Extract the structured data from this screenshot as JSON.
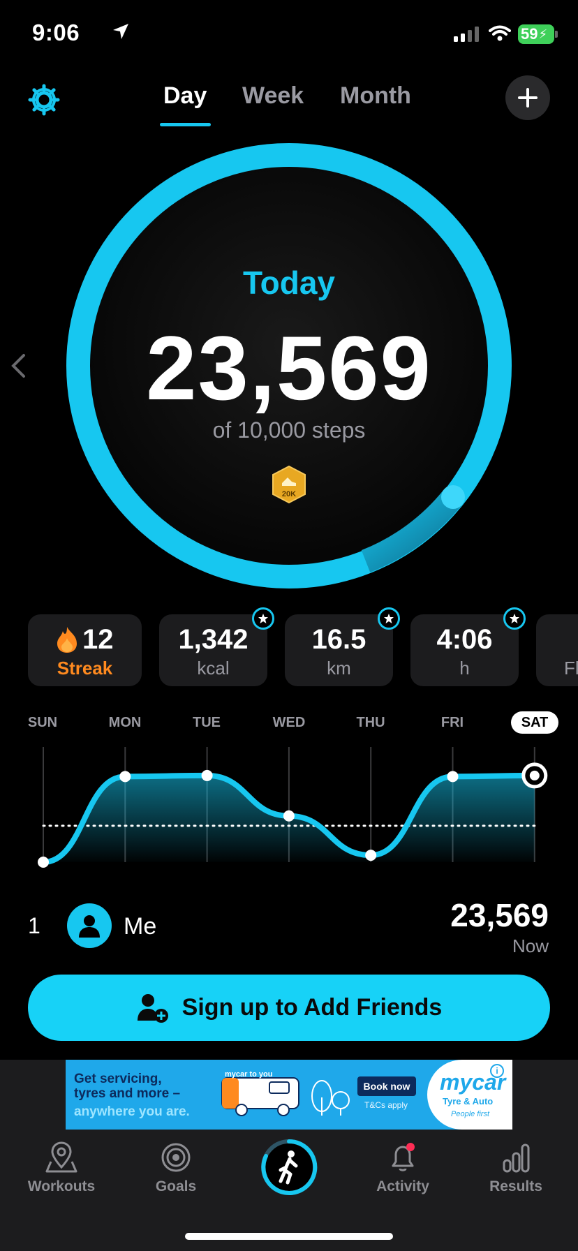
{
  "status_bar": {
    "time": "9:06",
    "battery": "59"
  },
  "header": {
    "tabs": [
      {
        "label": "Day",
        "active": true
      },
      {
        "label": "Week",
        "active": false
      },
      {
        "label": "Month",
        "active": false
      }
    ]
  },
  "today": {
    "label": "Today",
    "steps": "23,569",
    "goal_text": "of 10,000 steps",
    "badge": "20K",
    "goal_progress": 1.0
  },
  "stats": [
    {
      "value": "12",
      "unit": "Streak"
    },
    {
      "value": "1,342",
      "unit": "kcal"
    },
    {
      "value": "16.5",
      "unit": "km"
    },
    {
      "value": "4:06",
      "unit": "h"
    },
    {
      "value": "",
      "unit": "Fl"
    }
  ],
  "week_chart": {
    "days": [
      "SUN",
      "MON",
      "TUE",
      "WED",
      "THU",
      "FRI",
      "SAT"
    ],
    "selected_day": "SAT",
    "relative_values": [
      0.0,
      0.87,
      0.88,
      0.47,
      0.07,
      0.87,
      0.88
    ],
    "goal_level": 0.37
  },
  "leaderboard": {
    "rank": "1",
    "name": "Me",
    "steps": "23,569",
    "time": "Now"
  },
  "signup_button": "Sign up to Add Friends",
  "ad": {
    "line1": "Get servicing,",
    "line2": "tyres and more –",
    "line3": "anywhere you are.",
    "van_label": "mycar to you",
    "cta": "Book now",
    "terms": "T&Cs apply",
    "brand": "mycar",
    "tagline": "Tyre & Auto",
    "slogan": "People first"
  },
  "nav": [
    {
      "label": "Workouts",
      "icon": "map-pin-icon"
    },
    {
      "label": "Goals",
      "icon": "target-icon"
    },
    {
      "label": "",
      "icon": "walking-icon"
    },
    {
      "label": "Activity",
      "icon": "bell-icon"
    },
    {
      "label": "Results",
      "icon": "bar-chart-icon"
    }
  ],
  "colors": {
    "accent": "#17c7f0",
    "streak": "#ff8a1f",
    "card": "#1c1c1e",
    "background": "#000000"
  }
}
